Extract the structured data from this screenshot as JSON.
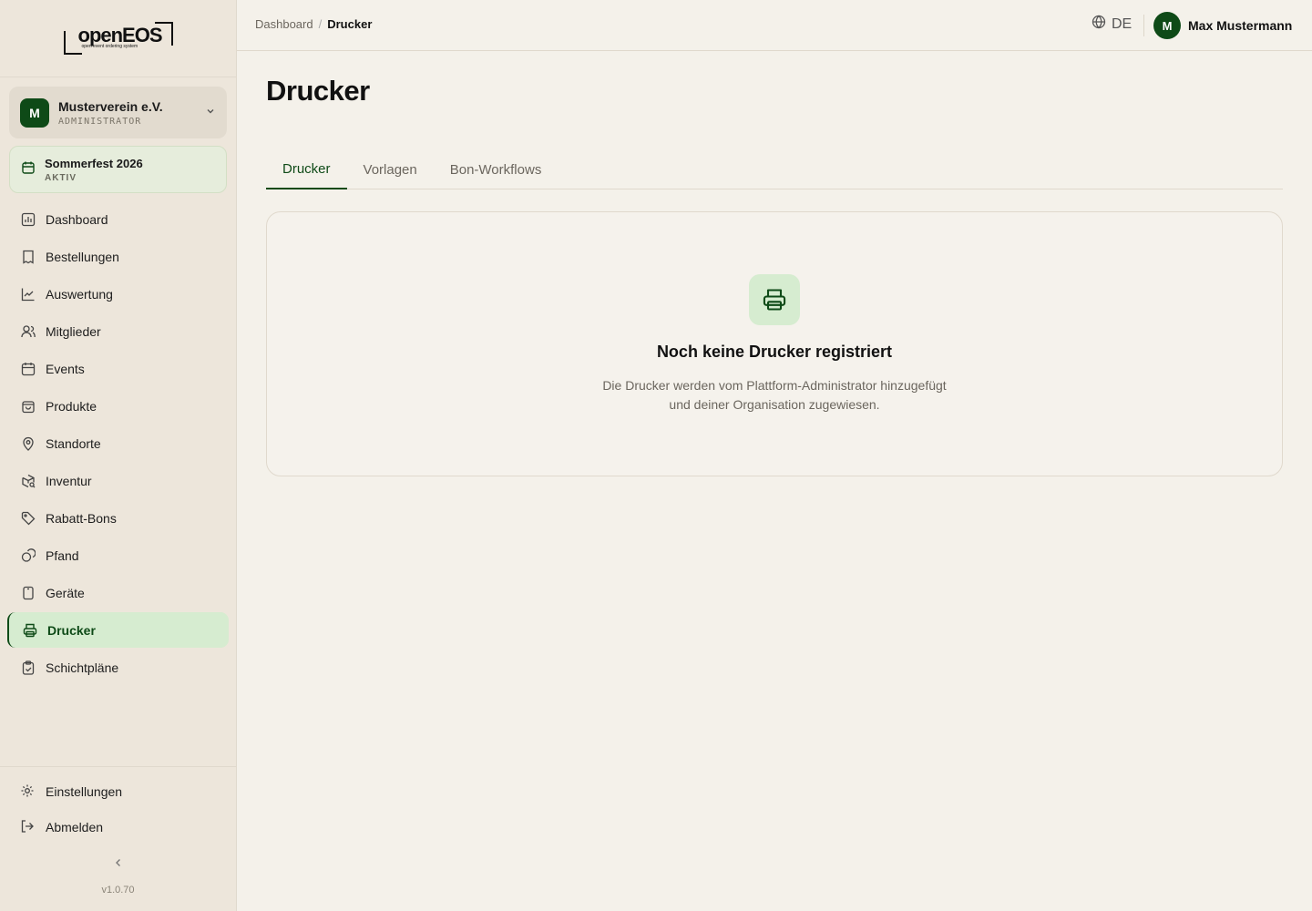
{
  "logo": {
    "text": "openEOS",
    "subtitle": "open event ordering system"
  },
  "org": {
    "avatar": "M",
    "name": "Musterverein e.V.",
    "role": "ADMINISTRATOR"
  },
  "event": {
    "name": "Sommerfest 2026",
    "status": "AKTIV"
  },
  "nav": {
    "items": [
      {
        "label": "Dashboard",
        "icon": "chart-icon"
      },
      {
        "label": "Bestellungen",
        "icon": "receipt-icon"
      },
      {
        "label": "Auswertung",
        "icon": "trend-icon"
      },
      {
        "label": "Mitglieder",
        "icon": "users-icon"
      },
      {
        "label": "Events",
        "icon": "calendar-icon"
      },
      {
        "label": "Produkte",
        "icon": "bag-icon"
      },
      {
        "label": "Standorte",
        "icon": "map-pin-icon"
      },
      {
        "label": "Inventur",
        "icon": "package-search-icon"
      },
      {
        "label": "Rabatt-Bons",
        "icon": "tag-icon"
      },
      {
        "label": "Pfand",
        "icon": "coins-icon"
      },
      {
        "label": "Geräte",
        "icon": "tablet-icon"
      },
      {
        "label": "Drucker",
        "icon": "printer-icon",
        "active": true
      },
      {
        "label": "Schichtpläne",
        "icon": "clipboard-check-icon"
      }
    ]
  },
  "bottom": {
    "settings": "Einstellungen",
    "logout": "Abmelden",
    "version": "v1.0.70"
  },
  "header": {
    "breadcrumb_root": "Dashboard",
    "breadcrumb_current": "Drucker",
    "language": "DE",
    "user_avatar": "M",
    "user_name": "Max Mustermann"
  },
  "main": {
    "title": "Drucker",
    "tabs": [
      "Drucker",
      "Vorlagen",
      "Bon-Workflows"
    ],
    "empty_title": "Noch keine Drucker registriert",
    "empty_desc": "Die Drucker werden vom Plattform-Administrator hinzugefügt und deiner Organisation zugewiesen."
  },
  "colors": {
    "accent": "#0e4a17",
    "active_bg": "#d6ecd0",
    "sidebar_bg": "#ede6db",
    "page_bg": "#f4f1ea"
  }
}
